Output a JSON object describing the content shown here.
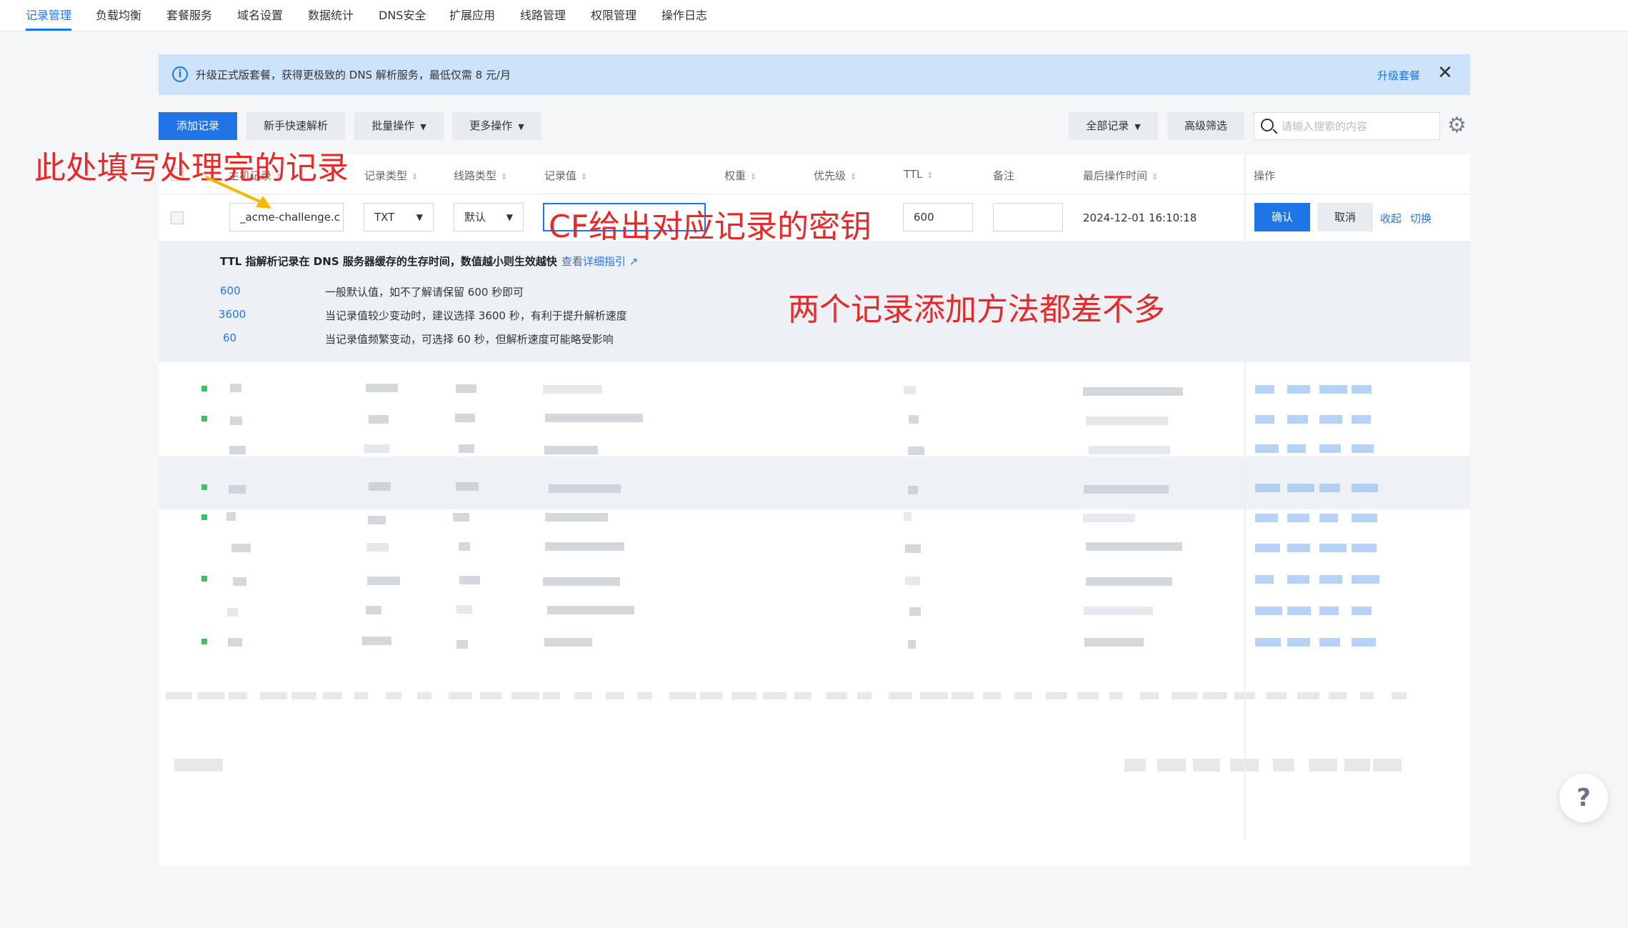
{
  "nav": {
    "tabs": [
      "记录管理",
      "负载均衡",
      "套餐服务",
      "域名设置",
      "数据统计",
      "DNS安全",
      "扩展应用",
      "线路管理",
      "权限管理",
      "操作日志"
    ],
    "active_index": 0
  },
  "banner": {
    "message": "升级正式版套餐，获得更极致的 DNS 解析服务，最低仅需 8 元/月",
    "upgrade_link": "升级套餐",
    "close_glyph": "✕"
  },
  "toolbar": {
    "add_record": "添加记录",
    "quick_parse": "新手快速解析",
    "batch_ops": "批量操作",
    "more_ops": "更多操作",
    "all_records": "全部记录",
    "advanced_filter": "高级筛选",
    "search_placeholder": "请输入搜索的内容"
  },
  "table": {
    "headers": {
      "host": "主机记录",
      "type": "记录类型",
      "line": "线路类型",
      "value": "记录值",
      "weight": "权重",
      "priority": "优先级",
      "ttl": "TTL",
      "remark": "备注",
      "updated": "最后操作时间",
      "actions": "操作"
    },
    "sort_glyph": "⇕",
    "edit_row": {
      "host": "_acme-challenge.c",
      "type": "TXT",
      "line": "默认",
      "value": "",
      "ttl": "600",
      "remark": "",
      "updated": "2024-12-01 16:10:18",
      "confirm": "确认",
      "cancel": "取消",
      "collapse": "收起",
      "switch": "切换"
    }
  },
  "ttl_tip": {
    "title": "TTL 指解析记录在 DNS 服务器缓存的生存时间，数值越小则生效越快",
    "guide_link": "查看详细指引 ↗",
    "options": [
      {
        "value": "600",
        "desc": "一般默认值，如不了解请保留 600 秒即可"
      },
      {
        "value": "3600",
        "desc": "当记录值较少变动时，建议选择 3600 秒，有利于提升解析速度"
      },
      {
        "value": "60",
        "desc": "当记录值频繁变动，可选择 60 秒，但解析速度可能略受影响"
      }
    ]
  },
  "annotations": {
    "host_note": "此处填写处理完的记录",
    "value_note": "CF给出对应记录的密钥",
    "general_note": "两个记录添加方法都差不多"
  },
  "help": "?",
  "colors": {
    "primary": "#1f75e6",
    "banner_bg": "#cce3fb",
    "annotation_red": "#e52a2a",
    "arrow_yellow": "#f5b800"
  }
}
